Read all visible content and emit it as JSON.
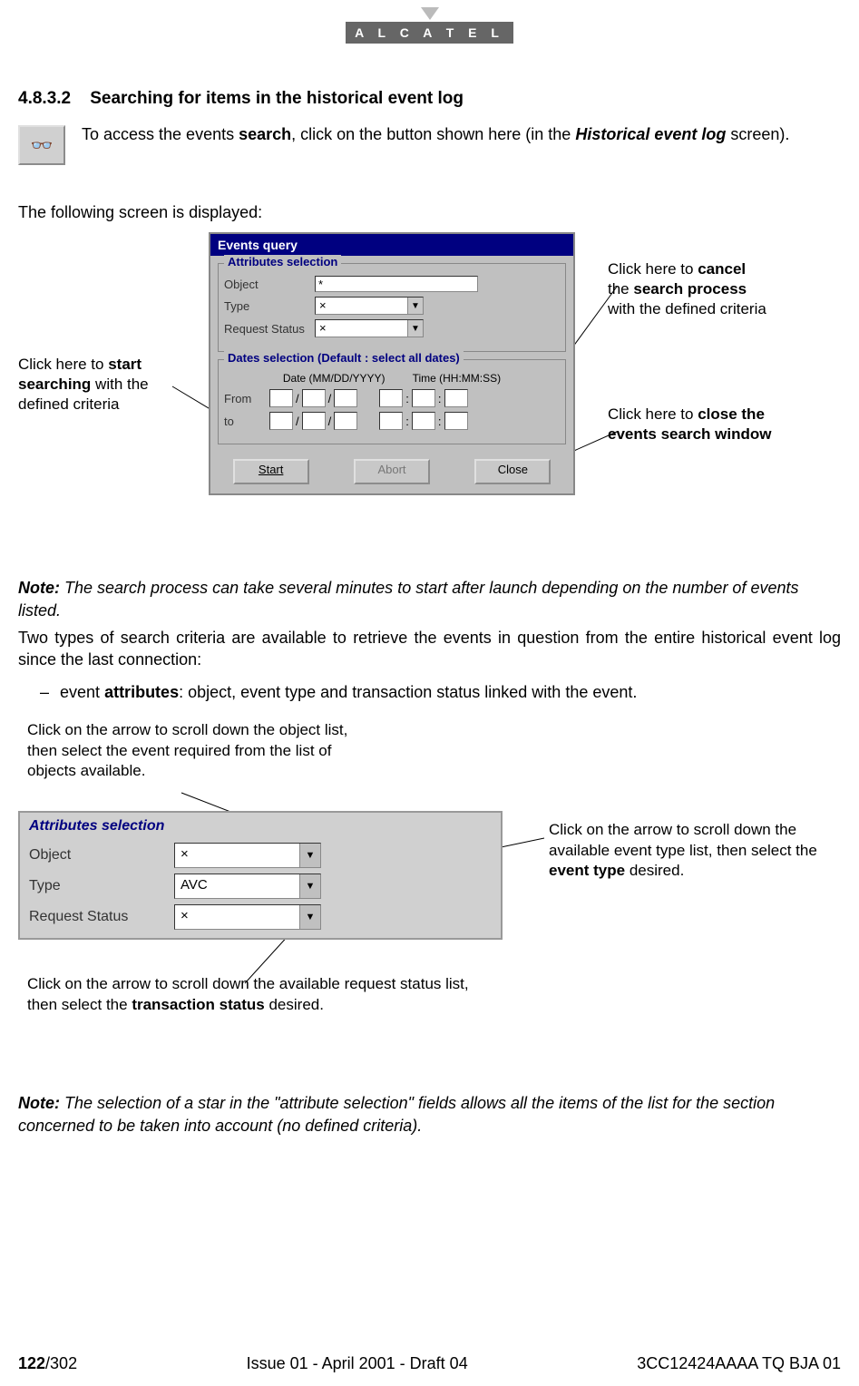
{
  "logo_text": "A L C A T E L",
  "section": {
    "number": "4.8.3.2",
    "title": "Searching for items in the historical event log"
  },
  "intro": {
    "p1_a": "To access the events ",
    "p1_b": "search",
    "p1_c": ", click on the button shown here (in the ",
    "p1_d": "Historical event log",
    "p1_e": " screen)."
  },
  "following_text": "The following screen is displayed:",
  "events_window": {
    "title": "Events query",
    "group1_title": "Attributes selection",
    "object_label": "Object",
    "object_value": "*",
    "type_label": "Type",
    "type_value": "×",
    "request_label": "Request Status",
    "request_value": "×",
    "group2_title": "Dates selection   (Default : select all dates)",
    "date_header": "Date (MM/DD/YYYY)",
    "time_header": "Time (HH:MM:SS)",
    "from_label": "From",
    "to_label": "to",
    "btn_start": "Start",
    "btn_abort": "Abort",
    "btn_close": "Close"
  },
  "callouts1": {
    "start_a": "Click here to ",
    "start_b": "start searching",
    "start_c": " with the defined criteria",
    "cancel_a": "Click here to ",
    "cancel_b": "cancel",
    "cancel_c": "the ",
    "cancel_d": "search process",
    "cancel_e": "with the defined criteria",
    "close_a": "Click here to ",
    "close_b": "close the events search window"
  },
  "note1": {
    "label": "Note:",
    "text": "The search process can take several minutes to start after launch depending on the number of events listed."
  },
  "para2": "Two types of search criteria are available to retrieve the events in question from the entire historical event log since the last connection:",
  "bullet": {
    "dash": "–",
    "a": "event ",
    "b": "attributes",
    "c": ": object, event type and transaction status linked with the event."
  },
  "callouts2": {
    "object_text": "Click on the arrow to scroll down the object list, then select the event required from the list of objects available.",
    "type_a": "Click on the arrow to scroll down the available event type list, then select the ",
    "type_b": "event type",
    "type_c": " desired.",
    "status_a": "Click on the arrow to scroll down the available request status list, then select the ",
    "status_b": "transaction status",
    "status_c": " desired."
  },
  "attr_panel": {
    "title": "Attributes selection",
    "object_label": "Object",
    "object_value": "×",
    "type_label": "Type",
    "type_value": "AVC",
    "request_label": "Request Status",
    "request_value": "×"
  },
  "note2": {
    "label": "Note:",
    "text": "The selection of a star in the \"attribute selection\" fields allows all the items of the list for the section concerned to be taken into account (no defined criteria)."
  },
  "footer": {
    "page_a": "122",
    "page_b": "/302",
    "center": "Issue 01 - April 2001 - Draft 04",
    "right": "3CC12424AAAA TQ BJA 01"
  }
}
